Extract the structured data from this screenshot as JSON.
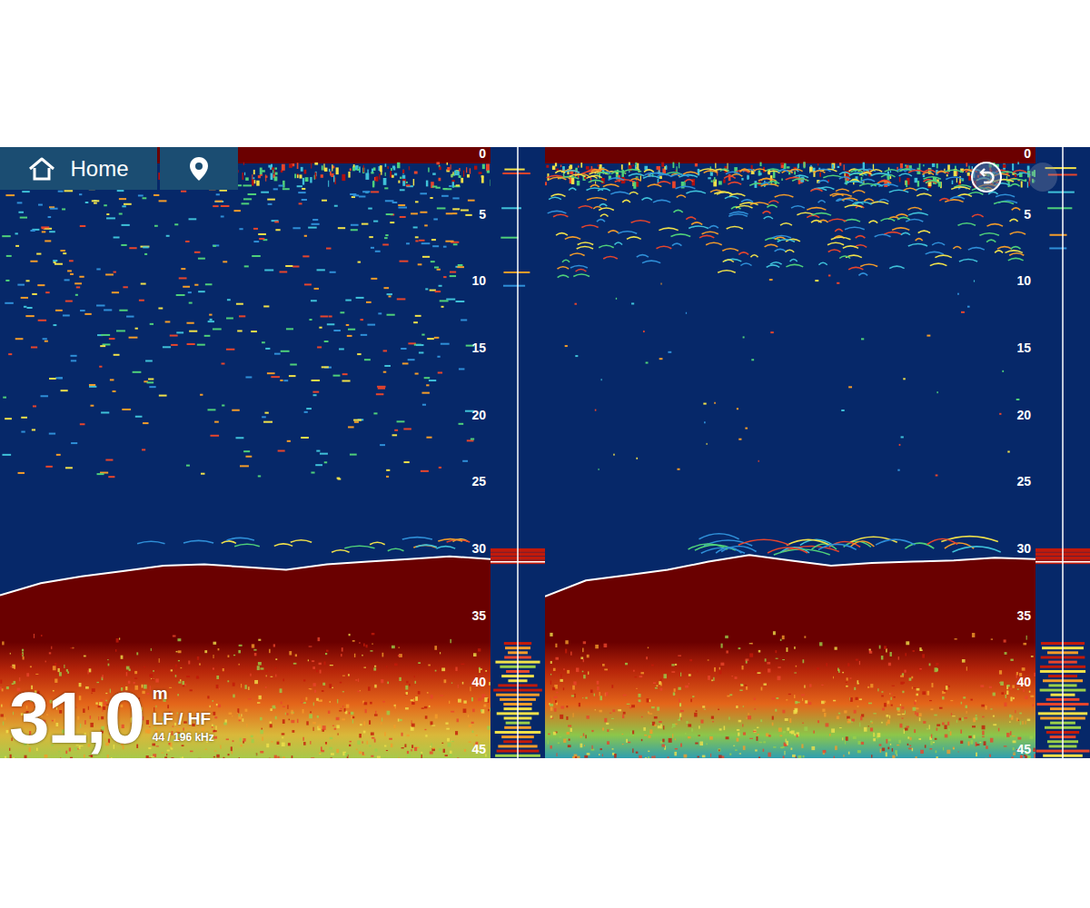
{
  "toolbar": {
    "home_label": "Home"
  },
  "depth_readout": {
    "value": "31,0",
    "unit": "m",
    "mode": "LF / HF",
    "frequency": "44 / 196 kHz"
  },
  "panels": [
    {
      "name": "LF",
      "scale_ticks": [
        "0",
        "5",
        "10",
        "15",
        "20",
        "25",
        "30",
        "35",
        "40",
        "45"
      ],
      "bottom": [
        33.5,
        32.6,
        32.1,
        31.7,
        31.3,
        31.2,
        31.4,
        31.6,
        31.2,
        31.0,
        30.8,
        30.6,
        30.8
      ]
    },
    {
      "name": "HF",
      "scale_ticks": [
        "0",
        "5",
        "10",
        "15",
        "20",
        "25",
        "30",
        "35",
        "40",
        "45"
      ],
      "bottom": [
        33.6,
        32.4,
        32.0,
        31.6,
        31.0,
        30.5,
        30.9,
        31.3,
        31.1,
        31.0,
        30.9,
        30.7,
        30.8
      ]
    }
  ]
}
